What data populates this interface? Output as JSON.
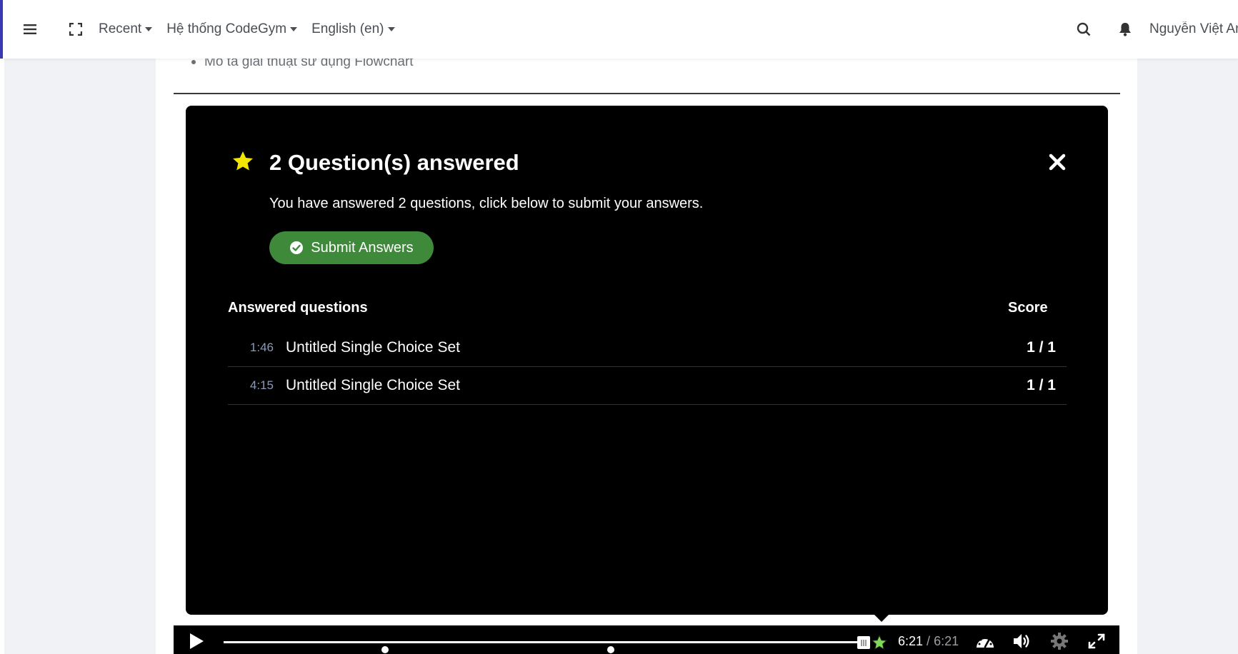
{
  "navbar": {
    "recent_label": "Recent",
    "system_label": "Hệ thống CodeGym",
    "language_label": "English (en)",
    "user_name": "Nguyễn Việt An"
  },
  "content": {
    "bullet_text": "Mô tả giải thuật sử dụng Flowchart"
  },
  "overlay": {
    "title": "2 Question(s) answered",
    "description": "You have answered 2 questions, click below to submit your answers.",
    "submit_label": "Submit Answers",
    "answered_header": "Answered questions",
    "score_header": "Score",
    "questions": [
      {
        "time": "1:46",
        "title": "Untitled Single Choice Set",
        "score": "1 / 1"
      },
      {
        "time": "4:15",
        "title": "Untitled Single Choice Set",
        "score": "1 / 1"
      }
    ]
  },
  "player": {
    "current_time": "6:21",
    "separator": " / ",
    "total_time": "6:21",
    "progress_fraction": 1.0,
    "marker_fractions": [
      0.2527,
      0.6056
    ]
  },
  "colors": {
    "accent": "#3b3ab0",
    "submit_green": "#3e8a3a",
    "star_yellow": "#f2e500",
    "bookmark_green": "#7ed957"
  }
}
